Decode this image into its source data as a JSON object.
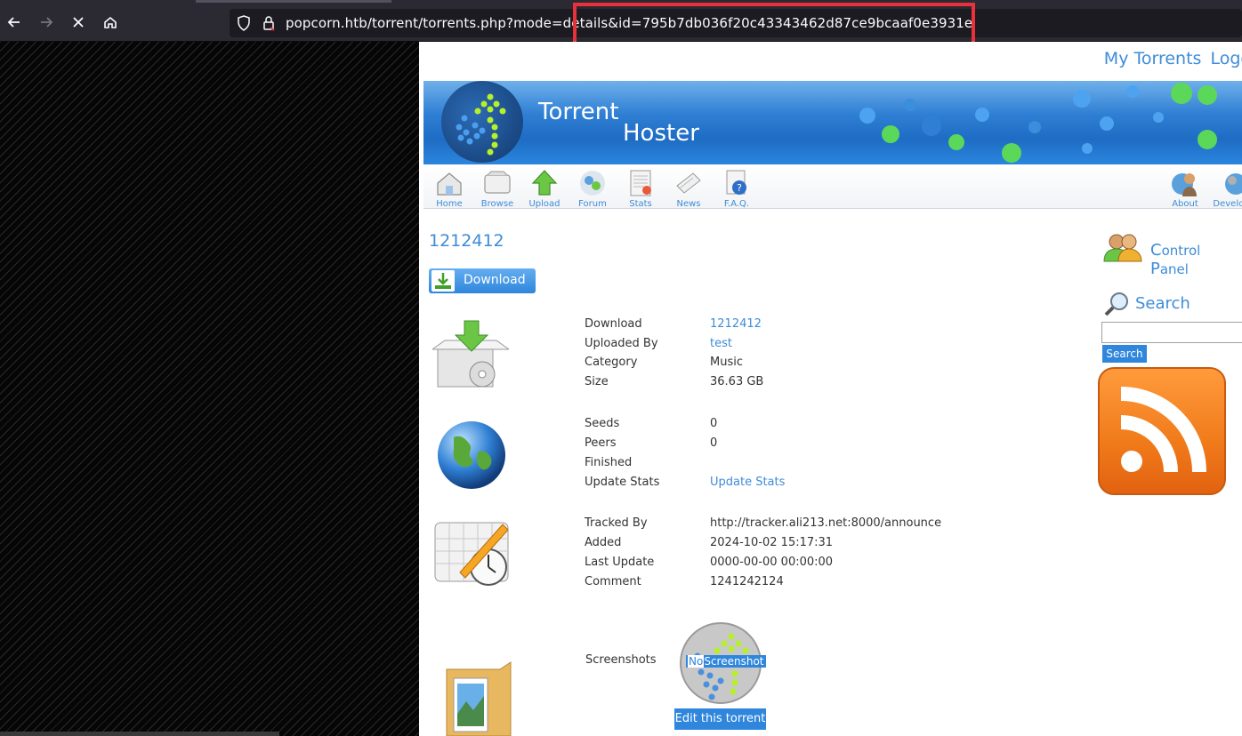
{
  "browser": {
    "url": "popcorn.htb/torrent/torrents.php?mode=details&id=795b7db036f20c43343462d87ce9bcaaf0e3931e",
    "icons": [
      "back-arrow-icon",
      "forward-arrow-icon",
      "stop-icon",
      "home-icon",
      "shield-icon",
      "lock-icon"
    ],
    "highlight_color": "#e8313a"
  },
  "header": {
    "my_torrents": "My Torrents",
    "logout": "Logo"
  },
  "banner": {
    "title_line1": "Torrent",
    "title_line2": "Hoster"
  },
  "menu": {
    "items": [
      {
        "label": "Home",
        "icon": "home-icon"
      },
      {
        "label": "Browse",
        "icon": "browse-icon"
      },
      {
        "label": "Upload",
        "icon": "upload-icon"
      },
      {
        "label": "Forum",
        "icon": "forum-icon"
      },
      {
        "label": "Stats",
        "icon": "stats-icon"
      },
      {
        "label": "News",
        "icon": "news-icon"
      },
      {
        "label": "F.A.Q.",
        "icon": "faq-icon"
      }
    ],
    "right_items": [
      {
        "label": "About",
        "icon": "about-icon"
      },
      {
        "label": "Develop",
        "icon": "developer-icon"
      }
    ]
  },
  "torrent": {
    "title": "1212412",
    "download_button": "Download",
    "details": {
      "download_label": "Download",
      "download_value": "1212412",
      "uploaded_by_label": "Uploaded By",
      "uploaded_by_value": "test",
      "category_label": "Category",
      "category_value": "Music",
      "size_label": "Size",
      "size_value": "36.63 GB"
    },
    "stats": {
      "seeds_label": "Seeds",
      "seeds_value": "0",
      "peers_label": "Peers",
      "peers_value": "0",
      "finished_label": "Finished",
      "finished_value": "",
      "update_stats_label": "Update Stats",
      "update_stats_value": "Update Stats"
    },
    "tracking": {
      "tracked_by_label": "Tracked By",
      "tracked_by_value": "http://tracker.ali213.net:8000/announce",
      "added_label": "Added",
      "added_value": "2024-10-02 15:17:31",
      "last_update_label": "Last Update",
      "last_update_value": "0000-00-00 00:00:00",
      "comment_label": "Comment",
      "comment_value": "1241242124"
    },
    "screenshots_label": "Screenshots",
    "no_screenshot_no": "No",
    "no_screenshot_rest": "Screenshot",
    "edit_button": "Edit this torrent"
  },
  "sidebar": {
    "control_panel_C": "C",
    "control_panel_ontrol": "ontrol ",
    "control_panel_P": "P",
    "control_panel_anel": "anel",
    "search_title": "Search",
    "search_value": "",
    "search_button": "Search"
  },
  "colors": {
    "link": "#3d8cd8",
    "button": "#2f86dc",
    "rss": "#f07a1a"
  }
}
